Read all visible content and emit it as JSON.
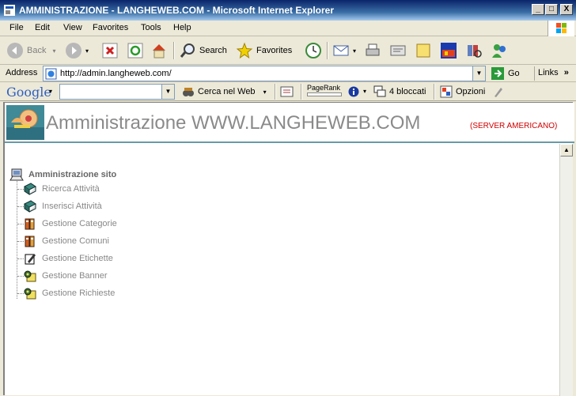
{
  "window": {
    "title": "AMMINISTRAZIONE - LANGHEWEB.COM - Microsoft Internet Explorer",
    "minimize": "_",
    "maximize": "□",
    "close": "X"
  },
  "menu": [
    "File",
    "Edit",
    "View",
    "Favorites",
    "Tools",
    "Help"
  ],
  "toolbar": {
    "back": "Back",
    "search": "Search",
    "favorites": "Favorites"
  },
  "address": {
    "label": "Address",
    "url": "http://admin.langheweb.com/",
    "go": "Go",
    "links": "Links"
  },
  "googlebar": {
    "logo": "Google",
    "search_value": "",
    "cerca": "Cerca nel Web",
    "pagerank": "PageRank",
    "blocked": "4 bloccati",
    "opzioni": "Opzioni"
  },
  "page": {
    "title": "Amministrazione WWW.LANGHEWEB.COM",
    "server": "(SERVER AMERICANO)",
    "tree_root": "Amministrazione sito",
    "items": [
      {
        "label": "Ricerca Attività",
        "icon": "book-icon"
      },
      {
        "label": "Inserisci Attività",
        "icon": "book-icon"
      },
      {
        "label": "Gestione Categorie",
        "icon": "binder-icon"
      },
      {
        "label": "Gestione Comuni",
        "icon": "binder-icon"
      },
      {
        "label": "Gestione Etichette",
        "icon": "edit-icon"
      },
      {
        "label": "Gestione Banner",
        "icon": "key-icon"
      },
      {
        "label": "Gestione Richieste",
        "icon": "key-icon"
      }
    ]
  },
  "colors": {
    "title_bar": "#0a246a",
    "page_title": "#8a8a8a",
    "server_label": "#d00000",
    "tree_label": "#888888"
  }
}
